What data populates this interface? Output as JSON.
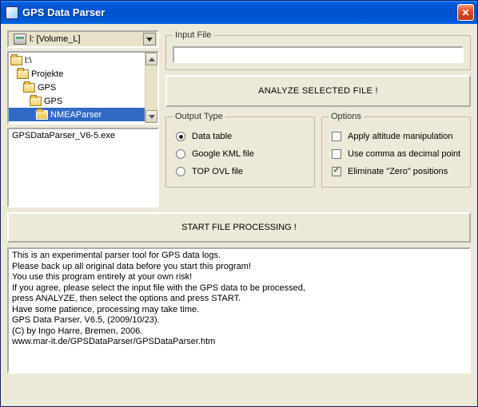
{
  "window": {
    "title": "GPS Data Parser"
  },
  "drive": {
    "label": "l: [Volume_L]"
  },
  "tree": {
    "items": [
      {
        "label": "l:\\",
        "indent": 0,
        "open": true,
        "selected": false
      },
      {
        "label": "Projekte",
        "indent": 1,
        "open": true,
        "selected": false
      },
      {
        "label": "GPS",
        "indent": 2,
        "open": true,
        "selected": false
      },
      {
        "label": "GPS",
        "indent": 3,
        "open": true,
        "selected": false
      },
      {
        "label": "NMEAParser",
        "indent": 4,
        "open": false,
        "selected": true
      }
    ]
  },
  "file_list": {
    "items": [
      "GPSDataParser_V6-5.exe"
    ]
  },
  "input_file": {
    "legend": "Input File",
    "value": ""
  },
  "analyze_button": "ANALYZE SELECTED FILE !",
  "output_type": {
    "legend": "Output Type",
    "options": [
      {
        "label": "Data table",
        "checked": true
      },
      {
        "label": "Google KML file",
        "checked": false
      },
      {
        "label": "TOP OVL file",
        "checked": false
      }
    ]
  },
  "options": {
    "legend": "Options",
    "items": [
      {
        "label": "Apply altitude manipulation",
        "checked": false
      },
      {
        "label": "Use comma as decimal point",
        "checked": false
      },
      {
        "label": "Eliminate \"Zero\" positions",
        "checked": true
      }
    ]
  },
  "start_button": "START FILE PROCESSING !",
  "log": {
    "lines": [
      "This is an experimental parser tool for GPS data logs.",
      "Please back up all original data before you start this program!",
      "You use this program entirely at your own risk!",
      "If you agree, please select the input file with the GPS data to be processed,",
      "press ANALYZE, then select the options and press START.",
      "Have some patience, processing may take time.",
      "GPS Data Parser, V6.5, (2009/10/23).",
      "(C) by Ingo Harre, Bremen, 2006.",
      "www.mar-it.de/GPSDataParser/GPSDataParser.htm"
    ]
  }
}
